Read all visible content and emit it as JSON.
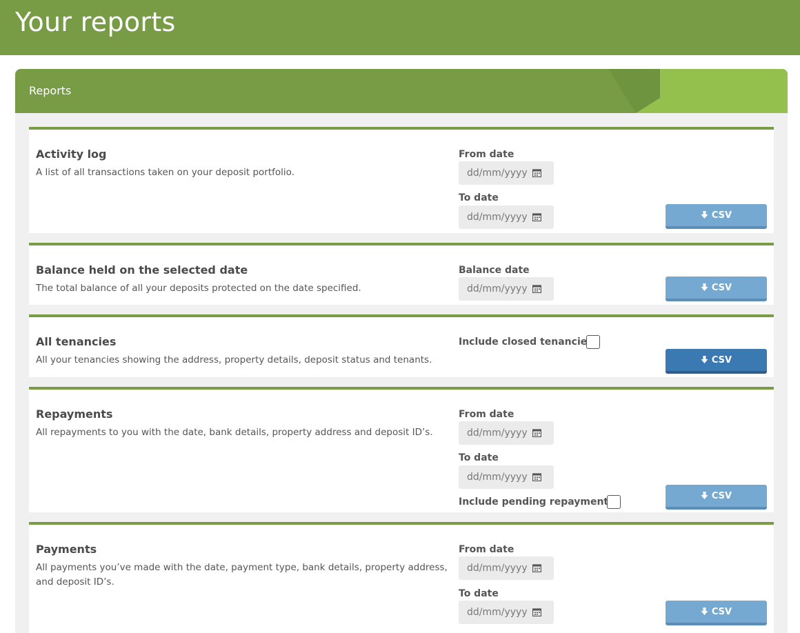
{
  "page": {
    "title": "Your reports"
  },
  "panel": {
    "title": "Reports"
  },
  "colors": {
    "brand_green": "#779c45",
    "light_green": "#94c04e",
    "button_blue": "#75a9d1",
    "button_active": "#3b79b2"
  },
  "date_placeholder": "dd/mm/yyyy",
  "button_label": "CSV",
  "reports": [
    {
      "title": "Activity log",
      "description": "A list of all transactions taken on your deposit portfolio.",
      "from_label": "From date",
      "to_label": "To date"
    },
    {
      "title": "Balance held on the selected date",
      "description": "The total balance of all your deposits protected on the date specified.",
      "balance_label": "Balance date"
    },
    {
      "title": "All tenancies",
      "description": "All your tenancies showing the address, property details, deposit status and tenants.",
      "checkbox_label": "Include closed tenancies"
    },
    {
      "title": "Repayments",
      "description": "All repayments to you with the date, bank details, property address and deposit ID’s.",
      "from_label": "From date",
      "to_label": "To date",
      "checkbox_label": "Include pending repayments"
    },
    {
      "title": "Payments",
      "description": "All payments you’ve made with the date, payment type, bank details, property address, and deposit ID’s.",
      "from_label": "From date",
      "to_label": "To date"
    }
  ]
}
